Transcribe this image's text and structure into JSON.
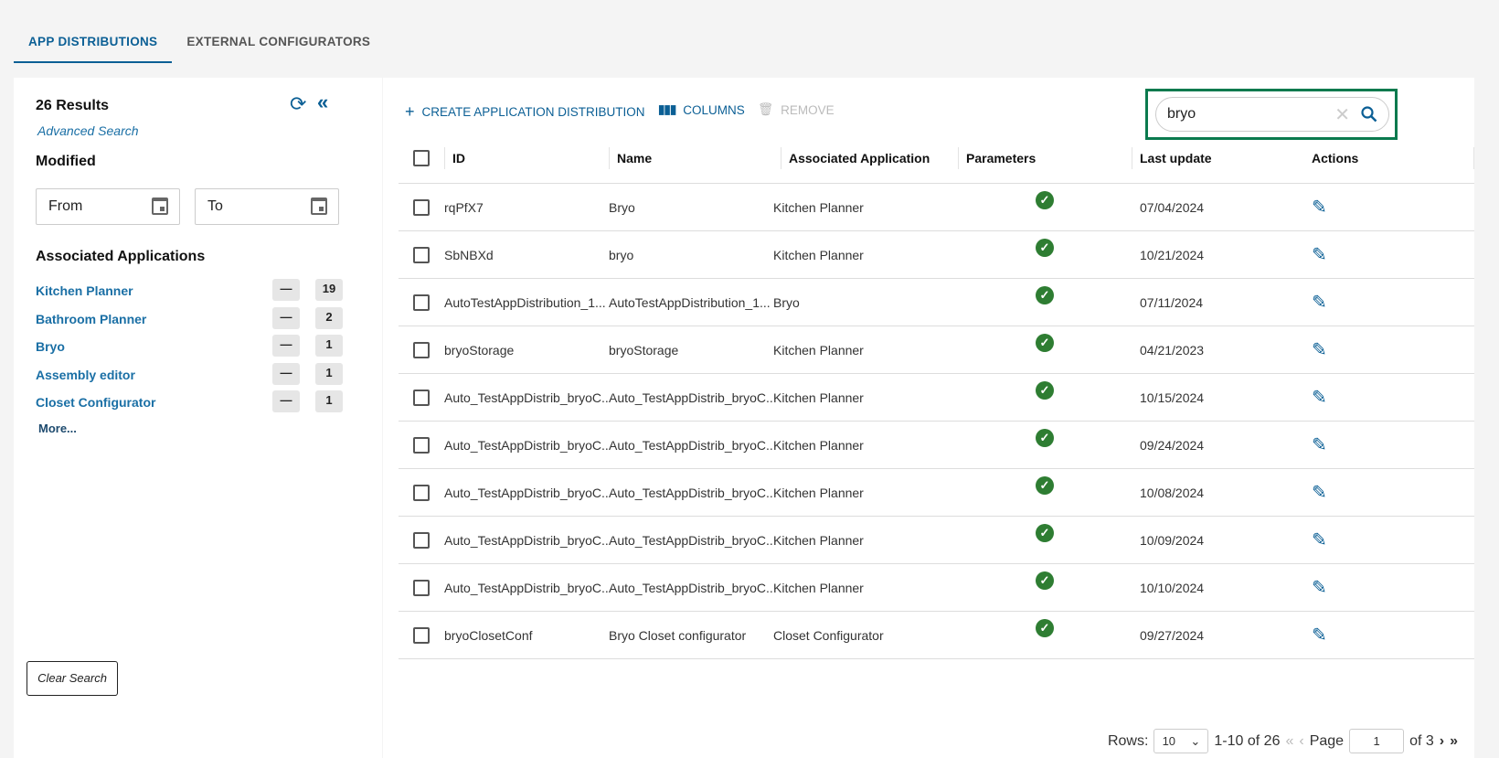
{
  "tabs": [
    {
      "label": "APP DISTRIBUTIONS",
      "active": true
    },
    {
      "label": "EXTERNAL CONFIGURATORS",
      "active": false
    }
  ],
  "sidebar": {
    "results": "26 Results",
    "advanced_search": "Advanced Search",
    "modified_label": "Modified",
    "from_placeholder": "From",
    "to_placeholder": "To",
    "associated_label": "Associated Applications",
    "apps": [
      {
        "label": "Kitchen Planner",
        "count": "19"
      },
      {
        "label": "Bathroom Planner",
        "count": "2"
      },
      {
        "label": "Bryo",
        "count": "1"
      },
      {
        "label": "Assembly editor",
        "count": "1"
      },
      {
        "label": "Closet Configurator",
        "count": "1"
      }
    ],
    "exclude_label": "—",
    "more": "More...",
    "clear_search": "Clear Search"
  },
  "toolbar": {
    "create": "CREATE APPLICATION DISTRIBUTION",
    "columns": "COLUMNS",
    "remove": "REMOVE"
  },
  "search": {
    "value": "bryo"
  },
  "table": {
    "headers": [
      "ID",
      "Name",
      "Associated Application",
      "Parameters",
      "Last update",
      "Actions"
    ],
    "rows": [
      [
        "rqPfX7",
        "Bryo",
        "Kitchen Planner",
        "07/04/2024"
      ],
      [
        "SbNBXd",
        "bryo",
        "Kitchen Planner",
        "10/21/2024"
      ],
      [
        "AutoTestAppDistribution_1...",
        "AutoTestAppDistribution_1...",
        "Bryo",
        "07/11/2024"
      ],
      [
        "bryoStorage",
        "bryoStorage",
        "Kitchen Planner",
        "04/21/2023"
      ],
      [
        "Auto_TestAppDistrib_bryoC...",
        "Auto_TestAppDistrib_bryoC...",
        "Kitchen Planner",
        "10/15/2024"
      ],
      [
        "Auto_TestAppDistrib_bryoC...",
        "Auto_TestAppDistrib_bryoC...",
        "Kitchen Planner",
        "09/24/2024"
      ],
      [
        "Auto_TestAppDistrib_bryoC...",
        "Auto_TestAppDistrib_bryoC...",
        "Kitchen Planner",
        "10/08/2024"
      ],
      [
        "Auto_TestAppDistrib_bryoC...",
        "Auto_TestAppDistrib_bryoC...",
        "Kitchen Planner",
        "10/09/2024"
      ],
      [
        "Auto_TestAppDistrib_bryoC...",
        "Auto_TestAppDistrib_bryoC...",
        "Kitchen Planner",
        "10/10/2024"
      ],
      [
        "bryoClosetConf",
        "Bryo Closet configurator",
        "Closet Configurator",
        "09/27/2024"
      ]
    ]
  },
  "pagination": {
    "rows_label": "Rows:",
    "rows_value": "10",
    "range": "1-10 of 26",
    "page_label": "Page",
    "page": "1",
    "of": "of 3"
  },
  "colors": {
    "accent": "#0b5f95",
    "highlight": "#0b7a4e",
    "ok": "#2e7d32"
  }
}
